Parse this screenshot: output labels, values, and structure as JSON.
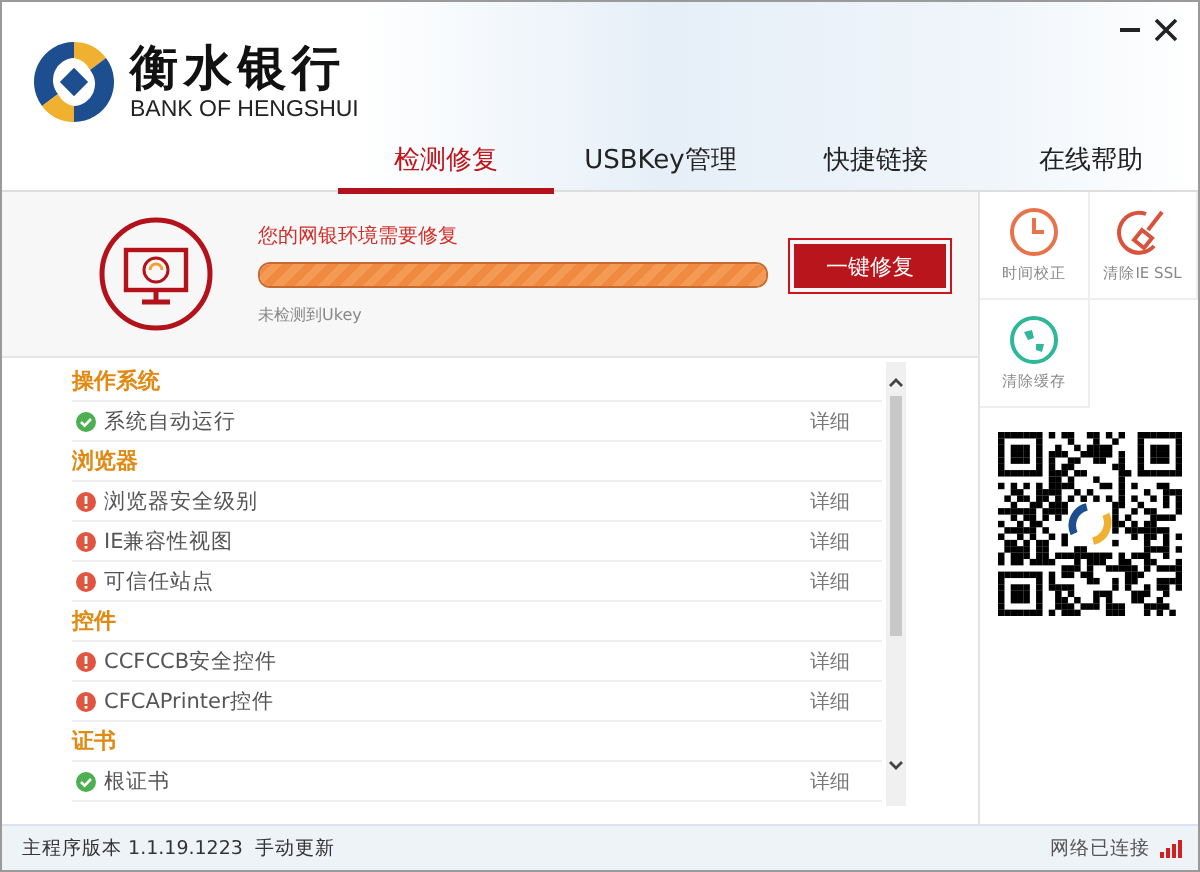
{
  "brand": {
    "name": "衡水银行",
    "subtitle": "BANK OF HENGSHUI"
  },
  "tabs": [
    {
      "label": "检测修复",
      "selected": true
    },
    {
      "label": "USBKey管理",
      "selected": false
    },
    {
      "label": "快捷链接",
      "selected": false
    },
    {
      "label": "在线帮助",
      "selected": false
    }
  ],
  "status_panel": {
    "message": "您的网银环境需要修复",
    "level": 1,
    "note": "未检测到Ukey",
    "fix_button": "一键修复"
  },
  "sections": [
    {
      "title": "操作系统",
      "items": [
        {
          "name": "系统自动运行",
          "passed": true,
          "action": "详细"
        }
      ]
    },
    {
      "title": "浏览器",
      "items": [
        {
          "name": "浏览器安全级别",
          "passed": false,
          "action": "详细"
        },
        {
          "name": "IE兼容性视图",
          "passed": false,
          "action": "详细"
        },
        {
          "name": "可信任站点",
          "passed": false,
          "action": "详细"
        }
      ]
    },
    {
      "title": "控件",
      "items": [
        {
          "name": "CCFCCB安全控件",
          "passed": false,
          "action": "详细"
        },
        {
          "name": "CFCAPrinter控件",
          "passed": false,
          "action": "详细"
        }
      ]
    },
    {
      "title": "证书",
      "items": [
        {
          "name": "根证书",
          "passed": true,
          "action": "详细"
        }
      ]
    }
  ],
  "tools": [
    {
      "kind": "clock",
      "label": "时间校正"
    },
    {
      "kind": "brush",
      "label": "清除IE SSL"
    },
    {
      "kind": "globe",
      "label": "清除缓存"
    }
  ],
  "status_bar": {
    "version": "主程序版本 1.1.19.1223",
    "update_link": "手动更新",
    "network": "网络已连接"
  }
}
